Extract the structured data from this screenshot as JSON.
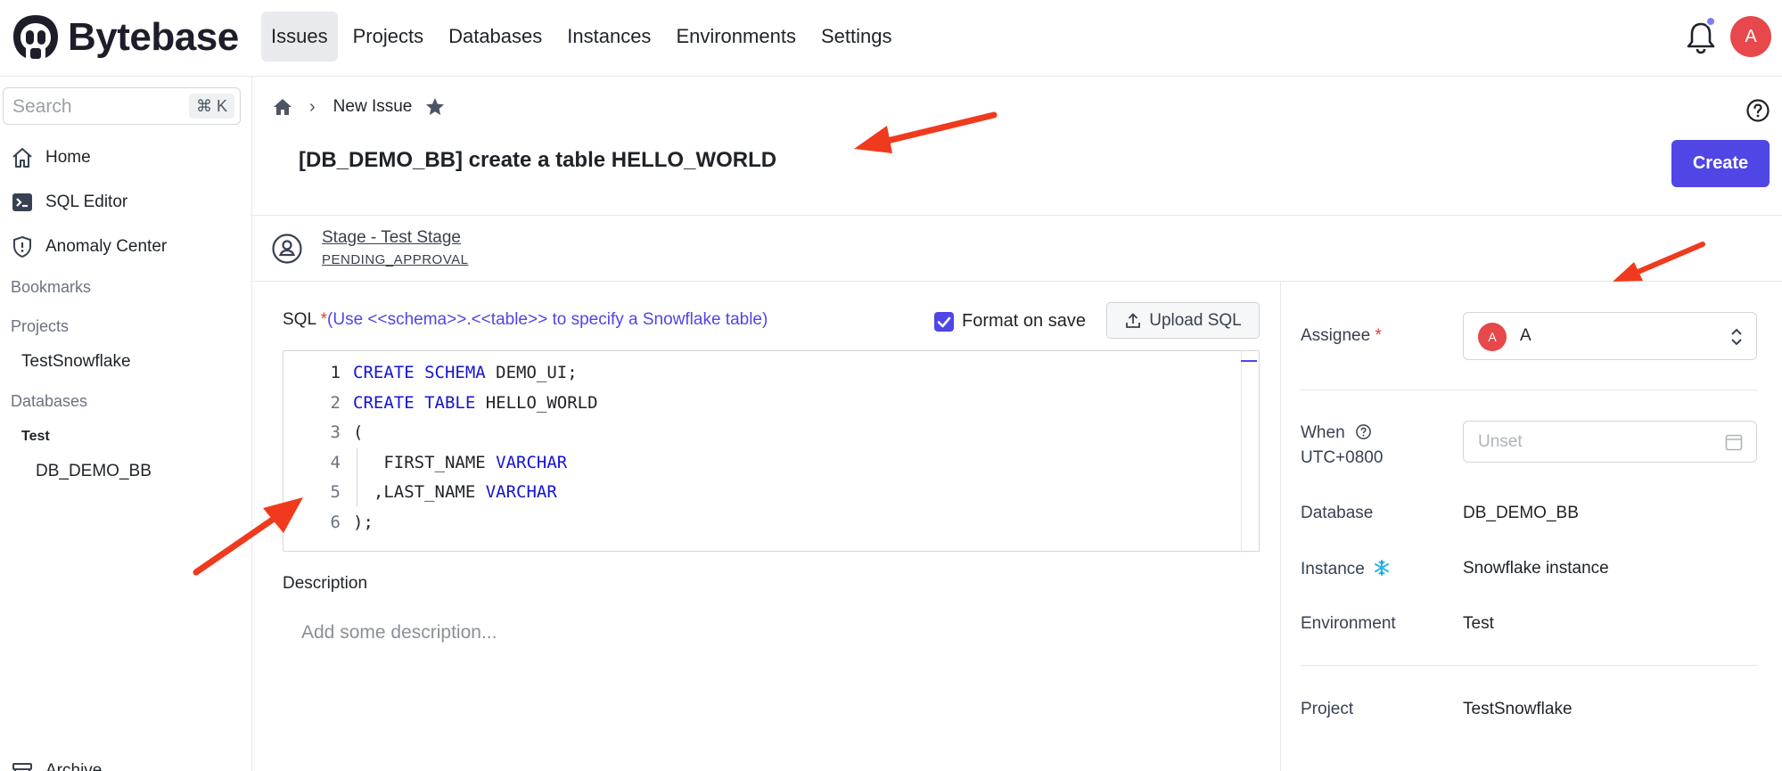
{
  "app": {
    "name": "Bytebase"
  },
  "nav": {
    "items": [
      {
        "label": "Issues",
        "active": true
      },
      {
        "label": "Projects"
      },
      {
        "label": "Databases"
      },
      {
        "label": "Instances"
      },
      {
        "label": "Environments"
      },
      {
        "label": "Settings"
      }
    ]
  },
  "user": {
    "initial": "A"
  },
  "sidebar": {
    "search_placeholder": "Search",
    "search_shortcut": "⌘ K",
    "items": [
      {
        "label": "Home",
        "icon": "home-icon"
      },
      {
        "label": "SQL Editor",
        "icon": "terminal-icon"
      },
      {
        "label": "Anomaly Center",
        "icon": "shield-icon"
      }
    ],
    "bookmarks_label": "Bookmarks",
    "projects_label": "Projects",
    "projects": [
      "TestSnowflake"
    ],
    "databases_label": "Databases",
    "environment": "Test",
    "databases": [
      "DB_DEMO_BB"
    ],
    "archive_label": "Archive"
  },
  "breadcrumb": {
    "current": "New Issue"
  },
  "issue": {
    "title": "[DB_DEMO_BB] create a table HELLO_WORLD",
    "create_label": "Create",
    "stage_name": "Stage - Test Stage",
    "stage_status": "PENDING_APPROVAL"
  },
  "sql": {
    "label": "SQL",
    "required_mark": "*",
    "hint": "(Use <<schema>>.<<table>> to specify a Snowflake table)",
    "format_on_save_label": "Format on save",
    "format_on_save_checked": true,
    "upload_label": "Upload SQL",
    "lines": [
      {
        "num": "1",
        "parts": [
          [
            "kw",
            "CREATE"
          ],
          [
            "t",
            " "
          ],
          [
            "kw",
            "SCHEMA"
          ],
          [
            "t",
            " DEMO_UI;"
          ]
        ]
      },
      {
        "num": "2",
        "parts": [
          [
            "kw",
            "CREATE"
          ],
          [
            "t",
            " "
          ],
          [
            "kw",
            "TABLE"
          ],
          [
            "t",
            " HELLO_WORLD"
          ]
        ]
      },
      {
        "num": "3",
        "parts": [
          [
            "t",
            "("
          ]
        ]
      },
      {
        "num": "4",
        "parts": [
          [
            "t",
            "   FIRST_NAME "
          ],
          [
            "kw",
            "VARCHAR"
          ]
        ]
      },
      {
        "num": "5",
        "parts": [
          [
            "t",
            "  ,LAST_NAME "
          ],
          [
            "kw",
            "VARCHAR"
          ]
        ]
      },
      {
        "num": "6",
        "parts": [
          [
            "t",
            ");"
          ]
        ]
      }
    ]
  },
  "description": {
    "label": "Description",
    "placeholder": "Add some description..."
  },
  "details": {
    "assignee_label": "Assignee",
    "assignee_initial": "A",
    "assignee_name": "A",
    "when_label": "When",
    "when_tz": "UTC+0800",
    "when_placeholder": "Unset",
    "database_label": "Database",
    "database_value": "DB_DEMO_BB",
    "instance_label": "Instance",
    "instance_value": "Snowflake instance",
    "environment_label": "Environment",
    "environment_value": "Test",
    "project_label": "Project",
    "project_value": "TestSnowflake"
  },
  "colors": {
    "primary": "#4f46e5",
    "danger": "#e53935",
    "avatar": "#e7484b",
    "annotation_arrow": "#f03a1d",
    "snowflake": "#29b5e8"
  }
}
